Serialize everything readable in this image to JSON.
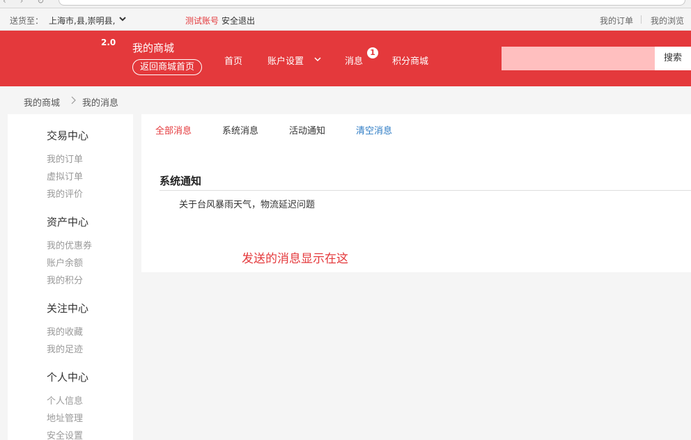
{
  "topbar": {
    "location_label": "送货至：",
    "location_value": "上海市,县,崇明县,",
    "account_name": "测试账号",
    "logout_label": "安全退出",
    "orders_label": "我的订单",
    "browse_label": "我的浏览"
  },
  "header": {
    "version": "2.0",
    "brand": "我的商城",
    "back_label": "返回商城首页",
    "nav": {
      "home": "首页",
      "account_settings": "账户设置",
      "messages": "消息",
      "messages_badge": "1",
      "points_mall": "积分商城"
    },
    "search": {
      "value": "",
      "button_label": "搜索"
    }
  },
  "breadcrumb": {
    "items": [
      "我的商城",
      "我的消息"
    ]
  },
  "sidebar": {
    "groups": [
      {
        "title": "交易中心",
        "items": [
          "我的订单",
          "虚拟订单",
          "我的评价"
        ]
      },
      {
        "title": "资产中心",
        "items": [
          "我的优惠券",
          "账户余额",
          "我的积分"
        ]
      },
      {
        "title": "关注中心",
        "items": [
          "我的收藏",
          "我的足迹"
        ]
      },
      {
        "title": "个人中心",
        "items": [
          "个人信息",
          "地址管理",
          "安全设置"
        ]
      }
    ]
  },
  "content": {
    "tabs": [
      "全部消息",
      "系统消息",
      "活动通知",
      "清空消息"
    ],
    "section_title": "系统通知",
    "messages": [
      "关于台风暴雨天气，物流延迟问题"
    ],
    "hint": "发送的消息显示在这"
  },
  "colors": {
    "brand_red": "#e4393c",
    "search_input_bg": "#ffbfbf",
    "link_blue": "#2c7bc4"
  }
}
